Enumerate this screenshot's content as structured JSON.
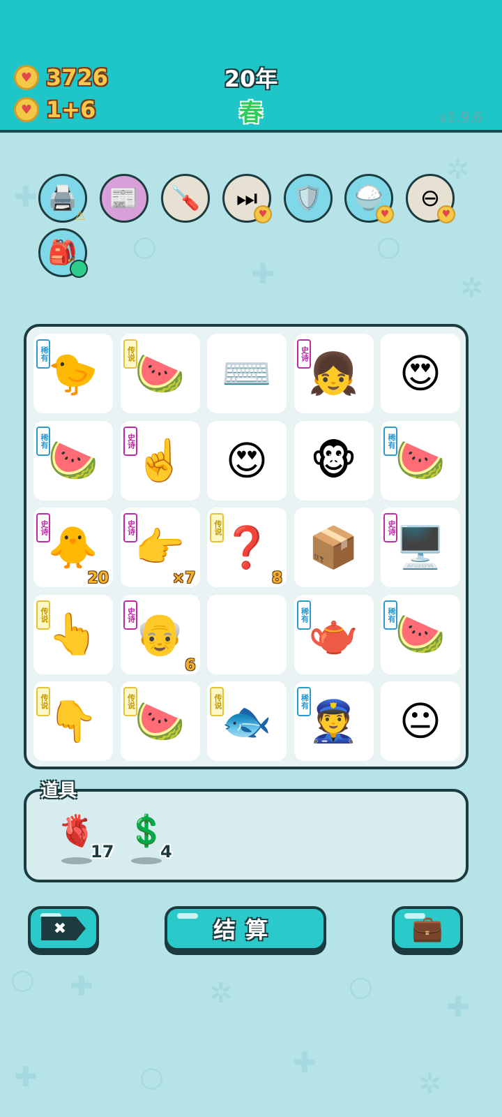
{
  "header": {
    "coins": "3726",
    "rate": "1+6",
    "year": "20年",
    "season": "春",
    "version": "v1.9.6"
  },
  "skills": [
    {
      "name": "printer-icon",
      "glyph": "🖨️",
      "bg": "#7fd8e8",
      "badge": "⚠"
    },
    {
      "name": "time-magazine-icon",
      "glyph": "📰",
      "bg": "#d8a0d8",
      "badge": ""
    },
    {
      "name": "screwdriver-icon",
      "glyph": "🪛",
      "bg": "#e6e1d2",
      "badge": ""
    },
    {
      "name": "skip-forward-icon",
      "glyph": "⏭",
      "bg": "#e6e1d2",
      "badge": "♥"
    },
    {
      "name": "shield-wrench-icon",
      "glyph": "🛡️",
      "bg": "#7fd8e8",
      "badge": ""
    },
    {
      "name": "rice-bowl-icon",
      "glyph": "🍚",
      "bg": "#7fd8e8",
      "badge": "♥"
    },
    {
      "name": "minus-circle-icon",
      "glyph": "⊖",
      "bg": "#e6e1d2",
      "badge": "♥"
    },
    {
      "name": "sack-icon",
      "glyph": "🎒",
      "bg": "#7fd8e8",
      "badge": "●"
    }
  ],
  "board": [
    {
      "name": "chick-icon",
      "art": "🐤",
      "tag": "稀有",
      "rarity": "rare",
      "count": ""
    },
    {
      "name": "watermelon-icon",
      "art": "🍉",
      "tag": "传说",
      "rarity": "legend",
      "count": ""
    },
    {
      "name": "keyboard-icon",
      "art": "⌨️",
      "tag": "",
      "rarity": "",
      "count": ""
    },
    {
      "name": "girl-face-icon",
      "art": "👧",
      "tag": "史诗",
      "rarity": "epic",
      "count": ""
    },
    {
      "name": "heart-eyes-man-icon",
      "art": "😍",
      "tag": "",
      "rarity": "",
      "count": ""
    },
    {
      "name": "watermelon-slice-icon",
      "art": "🍉",
      "tag": "稀有",
      "rarity": "rare",
      "count": ""
    },
    {
      "name": "pointing-hand-icon",
      "art": "☝️",
      "tag": "史诗",
      "rarity": "epic",
      "count": ""
    },
    {
      "name": "heart-eyes-grandpa-icon",
      "art": "😍",
      "tag": "",
      "rarity": "",
      "count": ""
    },
    {
      "name": "heart-eyes-monkey-icon",
      "art": "🐵",
      "tag": "",
      "rarity": "",
      "count": ""
    },
    {
      "name": "watermelon-slice-icon",
      "art": "🍉",
      "tag": "稀有",
      "rarity": "rare",
      "count": ""
    },
    {
      "name": "yellow-chick-face-icon",
      "art": "🐥",
      "tag": "史诗",
      "rarity": "epic",
      "count": "20"
    },
    {
      "name": "pointing-hand-icon",
      "art": "👉",
      "tag": "史诗",
      "rarity": "epic",
      "count": "×7"
    },
    {
      "name": "mystery-device-icon",
      "art": "❓",
      "tag": "传说",
      "rarity": "legend",
      "count": "8"
    },
    {
      "name": "cardboard-box-icon",
      "art": "📦",
      "tag": "",
      "rarity": "",
      "count": ""
    },
    {
      "name": "gpu-card-icon",
      "art": "🖥️",
      "tag": "史诗",
      "rarity": "epic",
      "count": ""
    },
    {
      "name": "golden-hand-icon",
      "art": "👆",
      "tag": "传说",
      "rarity": "legend",
      "count": ""
    },
    {
      "name": "old-man-glasses-icon",
      "art": "👴",
      "tag": "史诗",
      "rarity": "epic",
      "count": "6"
    },
    {
      "name": "empty-slot",
      "art": "",
      "tag": "",
      "rarity": "",
      "count": ""
    },
    {
      "name": "teapot-icon",
      "art": "🫖",
      "tag": "稀有",
      "rarity": "rare",
      "count": ""
    },
    {
      "name": "watermelon-slice-icon",
      "art": "🍉",
      "tag": "稀有",
      "rarity": "rare",
      "count": ""
    },
    {
      "name": "golden-hand-down-icon",
      "art": "👇",
      "tag": "传说",
      "rarity": "legend",
      "count": ""
    },
    {
      "name": "watermelon-icon",
      "art": "🍉",
      "tag": "传说",
      "rarity": "legend",
      "count": ""
    },
    {
      "name": "koi-fish-icon",
      "art": "🐟",
      "tag": "传说",
      "rarity": "legend",
      "count": ""
    },
    {
      "name": "police-officer-icon",
      "art": "👮",
      "tag": "稀有",
      "rarity": "rare",
      "count": ""
    },
    {
      "name": "man-face-icon",
      "art": "😐",
      "tag": "",
      "rarity": "",
      "count": ""
    }
  ],
  "props": {
    "title": "道具",
    "items": [
      {
        "name": "liver-icon",
        "art": "🫀",
        "count": "17"
      },
      {
        "name": "dollar-coin-icon",
        "art": "💲",
        "count": "4"
      }
    ]
  },
  "buttons": {
    "delete_glyph": "✖",
    "settle_label": "结算",
    "bag_glyph": "💼"
  }
}
